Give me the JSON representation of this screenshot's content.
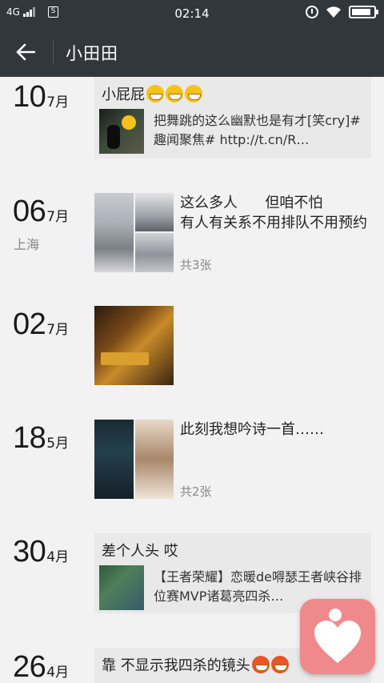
{
  "status_bar": {
    "network": "4G",
    "time": "02:14",
    "sim_label": "S",
    "battery_level": 0.9
  },
  "header": {
    "title": "小田田",
    "back_icon": "arrow-left-icon"
  },
  "posts": [
    {
      "day": "10",
      "month": "7月",
      "type": "share",
      "share_text": "小屁屁",
      "emoji_icon": "grinning-face-icon",
      "emoji_count": 3,
      "link_text": "把舞跳的这么幽默也是有才[笑cry]#趣闻聚焦# http://t.cn/R…"
    },
    {
      "day": "06",
      "month": "7月",
      "location": "上海",
      "type": "photos",
      "text": "这么多人      但咱不怕\n有人有关系不用排队不用预约",
      "photo_count": "共3张"
    },
    {
      "day": "02",
      "month": "7月",
      "type": "photo"
    },
    {
      "day": "18",
      "month": "5月",
      "type": "photos",
      "text": "此刻我想吟诗一首……",
      "photo_count": "共2张"
    },
    {
      "day": "30",
      "month": "4月",
      "type": "share",
      "share_text": "差个人头  哎",
      "link_text": "【王者荣耀】恋暖de嘚瑟王者峡谷排位赛MVP诸葛亮四杀…"
    },
    {
      "day": "26",
      "month": "4月",
      "type": "share",
      "share_text": "靠  不显示我四杀的镜头",
      "emoji_icon": "angry-face-icon"
    }
  ],
  "floating_app_icon": "heart-app-icon",
  "colors": {
    "bar": "#32373b",
    "background": "#f2f2f2",
    "card": "#e9e9e9",
    "fab": "#f0898b"
  }
}
